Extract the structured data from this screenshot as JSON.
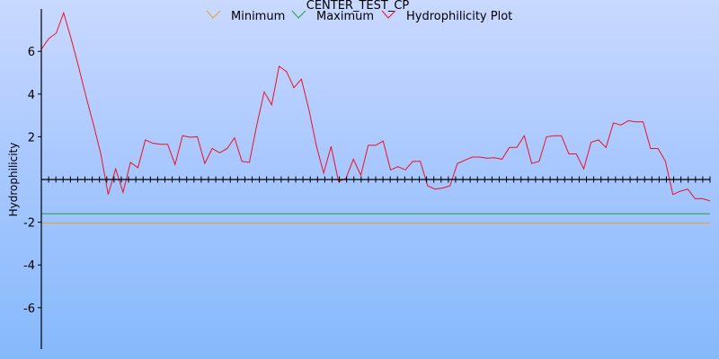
{
  "chart_data": {
    "type": "line",
    "title": "CENTER_TEST_CP",
    "xlabel": "",
    "ylabel": "Hydrophilicity",
    "ylim": [
      -7.9,
      7.9
    ],
    "yticks": [
      -6,
      -4,
      -2,
      2,
      4,
      6
    ],
    "grid": false,
    "legend_position": "top",
    "colors": {
      "minimum": "#f0a020",
      "maximum": "#20a040",
      "plot": "#ee1122",
      "axis": "#000000",
      "zero_line": "#000000"
    },
    "series": [
      {
        "name": "Minimum",
        "key": "minimum",
        "values": [
          -2.04,
          -2.04
        ]
      },
      {
        "name": "Maximum",
        "key": "maximum",
        "values": [
          -1.6,
          -1.6
        ]
      },
      {
        "name": "Hydrophilicity Plot",
        "key": "plot",
        "values": [
          6.1,
          6.6,
          6.85,
          7.8,
          6.6,
          5.3,
          3.9,
          2.6,
          1.2,
          -0.7,
          0.5,
          -0.6,
          0.8,
          0.55,
          1.85,
          1.7,
          1.65,
          1.65,
          0.7,
          2.05,
          1.98,
          2.0,
          0.75,
          1.45,
          1.25,
          1.45,
          1.95,
          0.85,
          0.8,
          2.55,
          4.1,
          3.5,
          5.3,
          5.05,
          4.3,
          4.7,
          3.3,
          1.6,
          0.3,
          1.55,
          -0.1,
          0.05,
          0.95,
          0.2,
          1.6,
          1.6,
          1.8,
          0.45,
          0.6,
          0.45,
          0.85,
          0.85,
          -0.3,
          -0.45,
          -0.4,
          -0.3,
          0.75,
          0.9,
          1.05,
          1.05,
          1.0,
          1.02,
          0.95,
          1.5,
          1.5,
          2.05,
          0.75,
          0.85,
          2.0,
          2.05,
          2.05,
          1.2,
          1.2,
          0.5,
          1.75,
          1.85,
          1.5,
          2.65,
          2.55,
          2.75,
          2.7,
          2.7,
          1.45,
          1.45,
          0.85,
          -0.7,
          -0.55,
          -0.45,
          -0.9,
          -0.9,
          -1.0
        ]
      }
    ]
  }
}
